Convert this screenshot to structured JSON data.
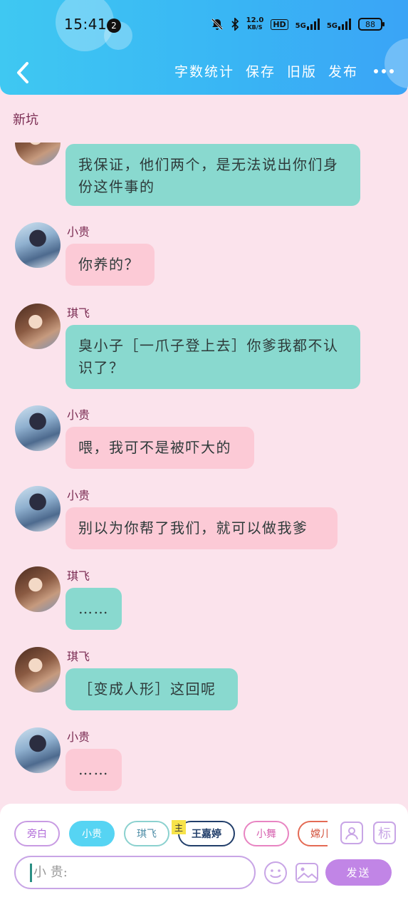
{
  "status_bar": {
    "time": "15:41",
    "notification_count": "2",
    "network_speed_value": "12.0",
    "network_speed_unit": "KB/S",
    "hd_label": "HD",
    "signal_1_label": "5G",
    "signal_2_label": "5G",
    "battery": "88"
  },
  "header": {
    "actions": {
      "word_count": "字数统计",
      "save": "保存",
      "old_version": "旧版",
      "publish": "发布"
    }
  },
  "chapter_title": "新坑",
  "messages": [
    {
      "speaker": "",
      "text": "我保证，他们两个，是无法说出你们身份这件事的"
    },
    {
      "speaker": "小贵",
      "text": "你养的？"
    },
    {
      "speaker": "琪飞",
      "text": "臭小子［一爪子登上去］你爹我都不认识了？"
    },
    {
      "speaker": "小贵",
      "text": "喂，我可不是被吓大的"
    },
    {
      "speaker": "小贵",
      "text": "别以为你帮了我们，就可以做我爹"
    },
    {
      "speaker": "琪飞",
      "text": "……"
    },
    {
      "speaker": "琪飞",
      "text": "［变成人形］这回呢"
    },
    {
      "speaker": "小贵",
      "text": "……"
    }
  ],
  "character_chips": {
    "narration": "旁白",
    "xiaogui": "小贵",
    "qifei": "琪飞",
    "main_tag": "主",
    "wangjiating": "王嘉婷",
    "xiaowu": "小舞",
    "can": "嫦儿"
  },
  "label_button": "标",
  "input": {
    "placeholder": "小 贵:"
  },
  "send_button": "发送",
  "colors": {
    "header": "#39b6f4",
    "background": "#fbe3ec",
    "teal_bubble": "#89d9cf",
    "pink_bubble": "#fccad6",
    "accent_purple": "#c185e6"
  }
}
